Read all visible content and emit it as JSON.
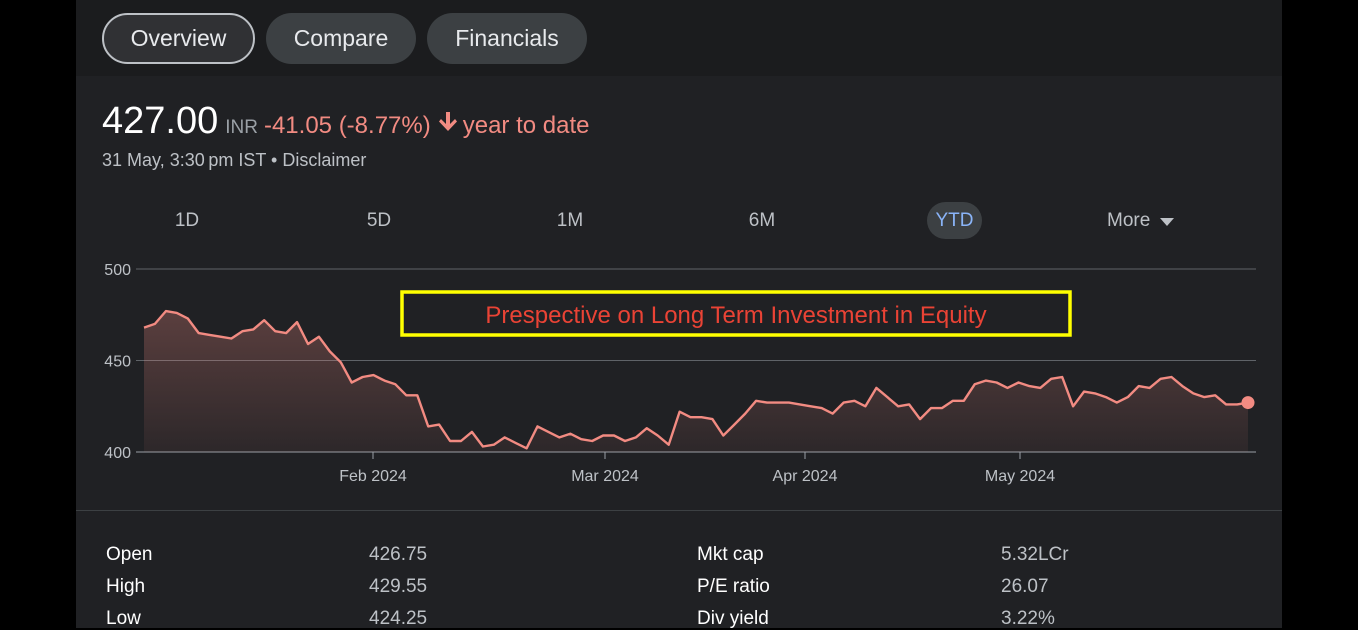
{
  "tabs": [
    {
      "label": "Overview",
      "active": true
    },
    {
      "label": "Compare",
      "active": false
    },
    {
      "label": "Financials",
      "active": false
    }
  ],
  "quote": {
    "price": "427.00",
    "currency": "INR",
    "change": "-41.05 (-8.77%)",
    "arrow_icon": "arrow-down-icon",
    "period": "year to date",
    "timestamp": "31 May, 3:30 pm IST",
    "separator": "•",
    "disclaimer": "Disclaimer",
    "change_color": "#f28b82"
  },
  "ranges": [
    {
      "label": "1D",
      "selected": false
    },
    {
      "label": "5D",
      "selected": false
    },
    {
      "label": "1M",
      "selected": false
    },
    {
      "label": "6M",
      "selected": false
    },
    {
      "label": "YTD",
      "selected": true
    },
    {
      "label": "More",
      "selected": false
    }
  ],
  "annotation": "Prespective on Long Term Investment in Equity",
  "colors": {
    "line": "#f28b82",
    "annotation_text": "#ea4335",
    "annotation_border": "#ffff00",
    "selected_range": "#8ab4f8"
  },
  "chart_data": {
    "type": "area",
    "title": "",
    "xlabel": "",
    "ylabel": "",
    "ylim": [
      400,
      500
    ],
    "y_ticks": [
      "500",
      "450",
      "400"
    ],
    "x_ticks": [
      "Feb 2024",
      "Mar 2024",
      "Apr 2024",
      "May 2024"
    ],
    "grid": true,
    "series": [
      {
        "values": [
          468,
          470,
          477,
          476,
          473,
          465,
          464,
          463,
          462,
          466,
          467,
          472,
          466,
          465,
          471,
          459,
          463,
          455,
          449,
          438,
          441,
          442,
          439,
          437,
          431,
          431,
          414,
          415,
          406,
          406,
          411,
          403,
          404,
          408,
          405,
          402,
          414,
          411,
          408,
          410,
          407,
          406,
          409,
          409,
          406,
          408,
          413,
          409,
          404,
          422,
          419,
          419,
          418,
          409,
          415,
          421,
          428,
          427,
          427,
          427,
          426,
          425,
          424,
          421,
          427,
          428,
          425,
          435,
          430,
          425,
          426,
          418,
          424,
          424,
          428,
          428,
          437,
          439,
          438,
          435,
          438,
          436,
          435,
          440,
          441,
          425,
          433,
          432,
          430,
          427,
          430,
          436,
          435,
          440,
          441,
          436,
          432,
          430,
          431,
          426,
          426,
          427
        ]
      }
    ]
  },
  "stats": {
    "left": [
      {
        "label": "Open",
        "value": "426.75"
      },
      {
        "label": "High",
        "value": "429.55"
      },
      {
        "label": "Low",
        "value": "424.25"
      }
    ],
    "right": [
      {
        "label": "Mkt cap",
        "value": "5.32LCr"
      },
      {
        "label": "P/E ratio",
        "value": "26.07"
      },
      {
        "label": "Div yield",
        "value": "3.22%"
      }
    ]
  }
}
